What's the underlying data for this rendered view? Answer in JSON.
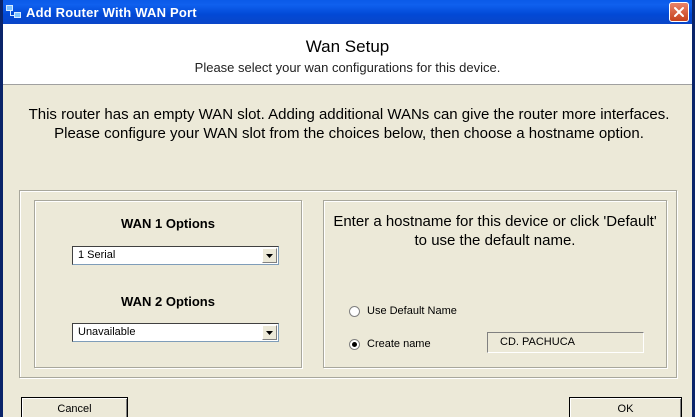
{
  "window": {
    "title": "Add Router With WAN Port",
    "icons": {
      "app": "router-network-icon",
      "close": "close-icon"
    }
  },
  "header": {
    "title": "Wan Setup",
    "subtitle": "Please select your wan configurations for this device."
  },
  "intro": "This router has an empty WAN slot. Adding additional WANs can give the router more interfaces. Please configure your WAN slot from the choices below, then choose a hostname option.",
  "wan": {
    "wan1_label": "WAN 1 Options",
    "wan1_value": "1 Serial",
    "wan2_label": "WAN 2 Options",
    "wan2_value": "Unavailable"
  },
  "hostname": {
    "instructions": "Enter a hostname for this device or click 'Default' to use the default name.",
    "use_default_label": "Use Default Name",
    "create_name_label": "Create name",
    "selected_option": "Create name",
    "name_value": "CD. PACHUCA"
  },
  "buttons": {
    "cancel": "Cancel",
    "ok": "OK"
  }
}
